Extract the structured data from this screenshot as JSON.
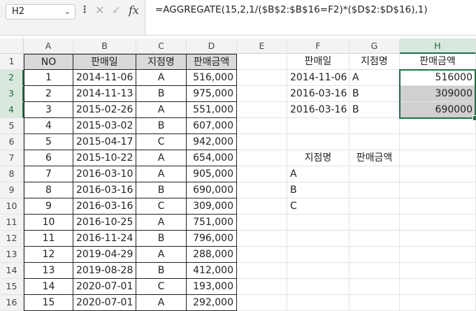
{
  "name_box": "H2",
  "formula": "=AGGREGATE(15,2,1/($B$2:$B$16=F2)*($D$2:$D$16),1)",
  "icons": {
    "cancel": "cancel-icon",
    "confirm": "check-icon",
    "fx": "fx-icon",
    "menu": "more-vert-icon",
    "dropdown": "chevron-down-icon"
  },
  "columns": [
    "A",
    "B",
    "C",
    "D",
    "E",
    "F",
    "G",
    "H"
  ],
  "rows": [
    "1",
    "2",
    "3",
    "4",
    "5",
    "6",
    "7",
    "8",
    "9",
    "10",
    "11",
    "12",
    "13",
    "14",
    "15",
    "16"
  ],
  "table": {
    "headers": [
      "NO",
      "판매일",
      "지점명",
      "판매금액"
    ],
    "rows": [
      [
        "1",
        "2014-11-06",
        "A",
        "516,000"
      ],
      [
        "2",
        "2014-11-13",
        "B",
        "975,000"
      ],
      [
        "3",
        "2015-02-26",
        "A",
        "551,000"
      ],
      [
        "4",
        "2015-03-02",
        "B",
        "607,000"
      ],
      [
        "5",
        "2015-04-17",
        "C",
        "942,000"
      ],
      [
        "6",
        "2015-10-22",
        "A",
        "654,000"
      ],
      [
        "7",
        "2016-03-10",
        "A",
        "905,000"
      ],
      [
        "8",
        "2016-03-16",
        "B",
        "690,000"
      ],
      [
        "9",
        "2016-03-16",
        "C",
        "309,000"
      ],
      [
        "10",
        "2016-10-25",
        "A",
        "751,000"
      ],
      [
        "11",
        "2016-11-24",
        "B",
        "796,000"
      ],
      [
        "12",
        "2019-04-29",
        "A",
        "288,000"
      ],
      [
        "13",
        "2019-08-28",
        "B",
        "412,000"
      ],
      [
        "14",
        "2020-07-01",
        "C",
        "193,000"
      ],
      [
        "15",
        "2020-07-01",
        "A",
        "292,000"
      ]
    ]
  },
  "result": {
    "headers": [
      "판매일",
      "지점명",
      "판매금액"
    ],
    "rows": [
      [
        "2014-11-06",
        "A",
        "516000"
      ],
      [
        "2016-03-16",
        "B",
        "309000"
      ],
      [
        "2016-03-16",
        "B",
        "690000"
      ]
    ]
  },
  "summary": {
    "headers": [
      "지점명",
      "판매금액"
    ],
    "items": [
      "A",
      "B",
      "C"
    ]
  }
}
